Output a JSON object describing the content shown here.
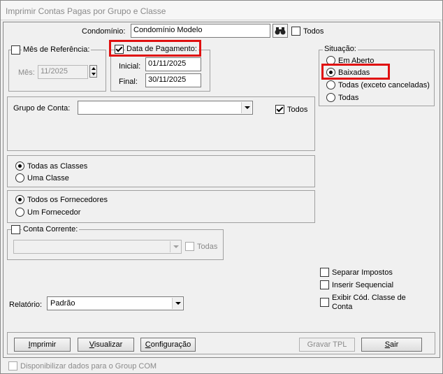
{
  "window": {
    "title": "Imprimir Contas Pagas por Grupo e Classe"
  },
  "condominio": {
    "label": "Condomínio:",
    "value": "Condomínio Modelo",
    "todos_label": "Todos",
    "todos_checked": false
  },
  "mes_referencia": {
    "label": "Mês de Referência:",
    "checked": false,
    "mes_label": "Mês:",
    "mes_value": "11/2025"
  },
  "data_pagamento": {
    "label": "Data de Pagamento:",
    "checked": true,
    "inicial_label": "Inicial:",
    "inicial_value": "01/11/2025",
    "final_label": "Final:",
    "final_value": "30/11/2025"
  },
  "situacao": {
    "label": "Situação:",
    "options": [
      "Em Aberto",
      "Baixadas",
      "Todas (exceto canceladas)",
      "Todas"
    ],
    "selected": "Baixadas"
  },
  "grupo_conta": {
    "label": "Grupo de Conta:",
    "value": "",
    "todos_label": "Todos",
    "todos_checked": true
  },
  "classes": {
    "options": [
      "Todas as Classes",
      "Uma Classe"
    ],
    "selected": "Todas as Classes"
  },
  "fornecedores": {
    "options": [
      "Todos os Fornecedores",
      "Um Fornecedor"
    ],
    "selected": "Todos os Fornecedores"
  },
  "conta_corrente": {
    "label": "Conta Corrente:",
    "checked": false,
    "value": "",
    "todas_label": "Todas"
  },
  "options": {
    "separar_impostos": "Separar Impostos",
    "inserir_sequencial": "Inserir Sequencial",
    "exibir_cod_line1": "Exibir Cód. Classe de",
    "exibir_cod_line2": "Conta"
  },
  "relatorio": {
    "label": "Relatório:",
    "value": "Padrão"
  },
  "buttons": {
    "imprimir": {
      "u": "I",
      "rest": "mprimir"
    },
    "visualizar": {
      "u": "V",
      "rest": "isualizar"
    },
    "configuracao": {
      "u": "C",
      "rest": "onfiguração"
    },
    "gravar_tpl": "Gravar TPL",
    "sair": {
      "u": "S",
      "rest": "air"
    }
  },
  "group_com": {
    "label": "Disponibilizar dados para o Group COM"
  },
  "colors": {
    "highlight": "#e01010"
  }
}
